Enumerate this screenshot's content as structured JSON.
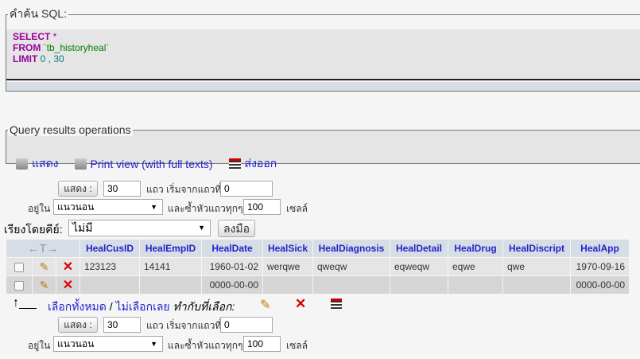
{
  "sql_box": {
    "legend": "คำค้น SQL:",
    "line1_kw": "SELECT",
    "line1_rest": " *",
    "line2_kw": "FROM",
    "line2_rest": " `tb_historyheal`",
    "line3_kw": "LIMIT",
    "line3_rest": " 0 , 30"
  },
  "operations": {
    "legend": "Query results operations",
    "show": "แสดง",
    "print_view": "Print view (with full texts)",
    "export": "ส่งออก"
  },
  "nav": {
    "show_button": "แสดง :",
    "rows": "30",
    "rows_label": "แถว เริ่มจากแถวที่",
    "start": "0",
    "in_label": "อยู่ใน",
    "mode": "แนวนอน",
    "repeat_label": "และซ้ำหัวแถวทุกๆ",
    "repeat": "100",
    "cells_label": "เซลล์"
  },
  "sort": {
    "label": "เรียงโดยคีย์:",
    "value": "ไม่มี",
    "go": "ลงมือ"
  },
  "table": {
    "arrows": "←T→",
    "columns": [
      "HealCusID",
      "HealEmpID",
      "HealDate",
      "HealSick",
      "HealDiagnosis",
      "HealDetail",
      "HealDrug",
      "HealDiscript",
      "HealApp"
    ],
    "rows": [
      [
        "123123",
        "14141",
        "1960-01-02",
        "werqwe",
        "qweqw",
        "eqweqw",
        "eqwe",
        "qwe",
        "1970-09-16"
      ],
      [
        "",
        "",
        "0000-00-00",
        "",
        "",
        "",
        "",
        "",
        "0000-00-00"
      ]
    ]
  },
  "bulk": {
    "check_all": "เลือกทั้งหมด",
    "sep": " / ",
    "uncheck_all": "ไม่เลือกเลย",
    "with_selected": "ทำกับที่เลือก:"
  }
}
